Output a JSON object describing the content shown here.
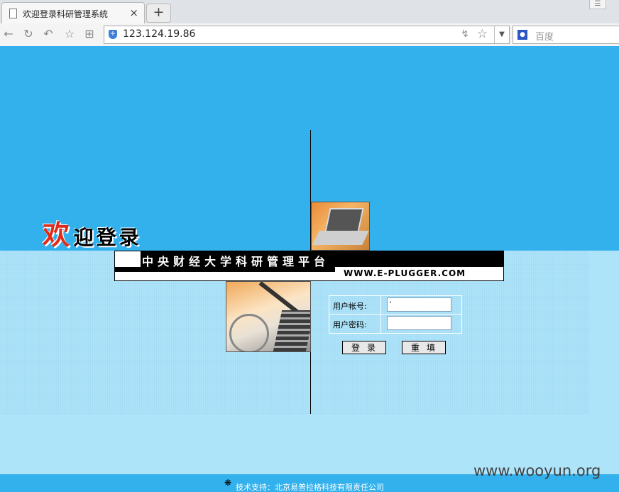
{
  "browser": {
    "tab_title": "欢迎登录科研管理系统",
    "tab_close": "×",
    "new_tab": "+",
    "address": "123.124.19.86",
    "search_placeholder": "百度",
    "window_btn": "☰"
  },
  "page": {
    "welcome_big": "欢",
    "welcome_rest": "迎登录",
    "banner_title": "中央财经大学科研管理平台",
    "banner_site": "WWW.E-PLUGGER.COM",
    "login": {
      "username_label": "用户帐号:",
      "username_value": "'",
      "password_label": "用户密码:",
      "password_value": ""
    },
    "login_button": "登录",
    "reset_button": "重填",
    "footer_text": "技术支持：北京易普拉格科技有限责任公司",
    "watermark": "www.wooyun.org"
  },
  "colors": {
    "top_band": "#33b1ec",
    "bottom_band": "#aee4fa",
    "accent_red": "#e02a1a"
  }
}
